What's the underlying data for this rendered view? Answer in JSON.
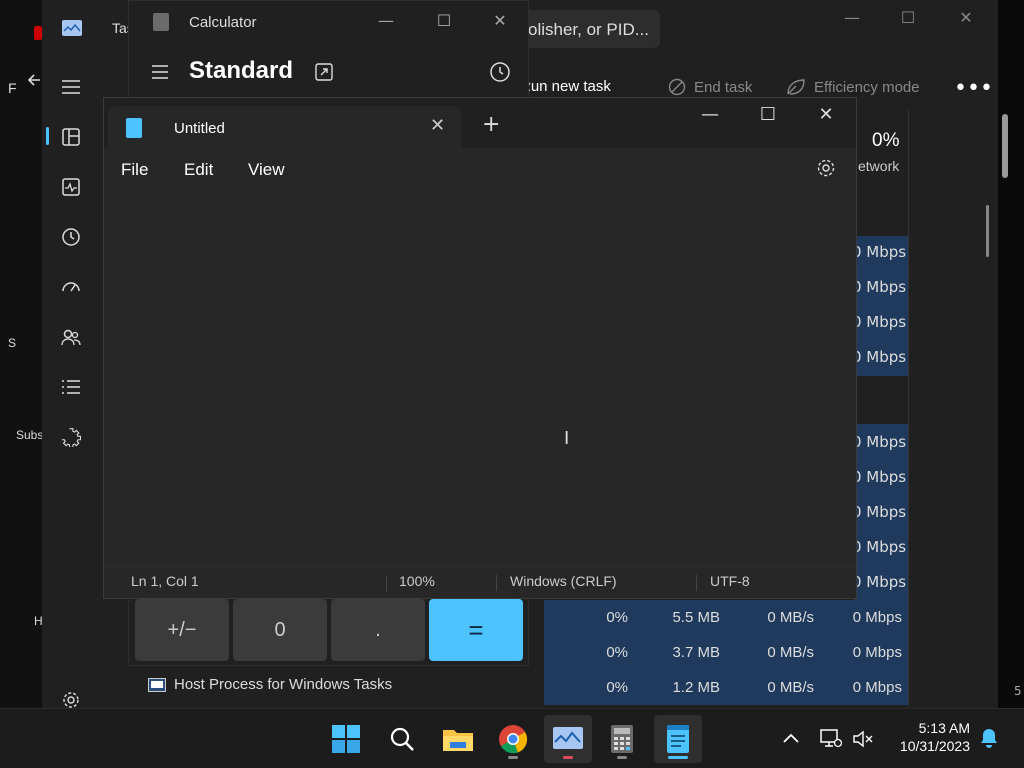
{
  "desktop": {
    "left_labels": [
      "F",
      "S",
      "Subs",
      "H"
    ]
  },
  "task_manager": {
    "title": "Tas",
    "search_placeholder": "olisher, or PID...",
    "toolbar": {
      "run_new_task": "Run new task",
      "end_task": "End task",
      "efficiency_mode": "Efficiency mode",
      "more": "•••"
    },
    "network_header": {
      "percent": "0%",
      "label": "etwork"
    },
    "network_values": [
      "0 Mbps",
      "0 Mbps",
      "0 Mbps",
      "0 Mbps"
    ],
    "network_values_2": [
      "0 Mbps",
      "0 Mbps",
      "0 Mbps",
      "0 Mbps",
      "0 Mbps"
    ],
    "rows": [
      {
        "cpu": "0%",
        "memory": "5.5 MB",
        "disk": "0 MB/s",
        "network": "0 Mbps"
      },
      {
        "cpu": "0%",
        "memory": "3.7 MB",
        "disk": "0 MB/s",
        "network": "0 Mbps"
      },
      {
        "cpu": "0%",
        "memory": "1.2 MB",
        "disk": "0 MB/s",
        "network": "0 Mbps"
      }
    ],
    "host_process": "Host Process for Windows Tasks",
    "right_edge_char": "5"
  },
  "calculator": {
    "title": "Calculator",
    "mode": "Standard",
    "keys": {
      "negate": "+/−",
      "zero": "0",
      "decimal": ".",
      "equals": "="
    }
  },
  "notepad": {
    "tab_title": "Untitled",
    "menu": {
      "file": "File",
      "edit": "Edit",
      "view": "View"
    },
    "status": {
      "position": "Ln 1, Col 1",
      "zoom": "100%",
      "line_ending": "Windows (CRLF)",
      "encoding": "UTF-8"
    }
  },
  "taskbar": {
    "time": "5:13 AM",
    "date": "10/31/2023"
  },
  "colors": {
    "accent": "#4cc2ff",
    "row_highlight": "#1f3a5c"
  }
}
